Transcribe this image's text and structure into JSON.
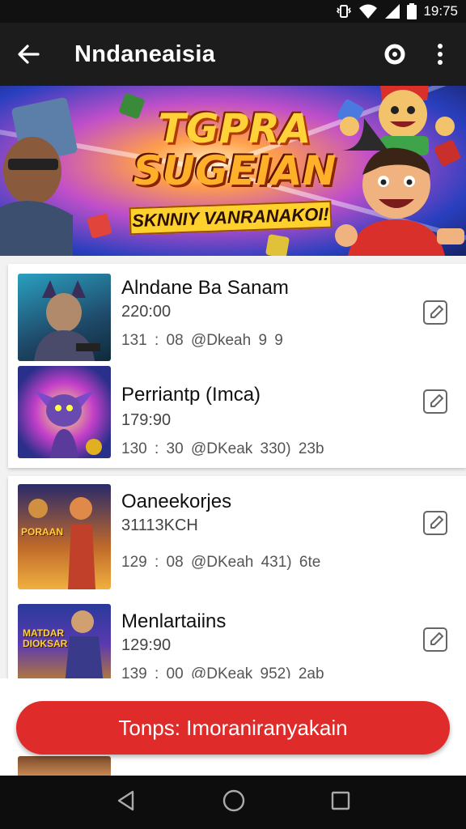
{
  "status_bar": {
    "time": "19:75",
    "icons": [
      "vibrate-icon",
      "wifi-icon",
      "signal-icon",
      "battery-icon"
    ]
  },
  "app_bar": {
    "title": "Nndaneaisia",
    "icons": [
      "back-arrow-icon",
      "search-icon",
      "more-vert-icon"
    ]
  },
  "banner": {
    "headline_line1": "TGPRA",
    "headline_line2": "SUGEIAN",
    "subtitle": "SKNNIY VANRANAKOI!"
  },
  "list": {
    "items": [
      {
        "title": "Alndane  Ba  Sanam",
        "subtitle": "220:00",
        "meta": "131 : 08   @Dkeah  9 9",
        "icon": "edit-icon"
      },
      {
        "title": "Perriantp  (Imca)",
        "subtitle": "179:90",
        "meta": "130 : 30   @DKeak  330)   23b",
        "icon": "edit-icon"
      },
      {
        "title": "Oaneekorjes",
        "subtitle": "31113KCH",
        "meta": "129 : 08   @DKeah  431)   6te",
        "icon": "edit-icon"
      },
      {
        "title": "Menlartaiins",
        "subtitle": "129:90",
        "meta": "139 : 00   @DKeak  952)   2ab",
        "icon": "edit-icon"
      }
    ],
    "thumb_texts": [
      "PORAAN",
      "MATDAR\nDIOKSAR"
    ]
  },
  "cta": {
    "label": "Tonps: Imoraniranyakain"
  },
  "nav_bar": {
    "icons": [
      "nav-back-icon",
      "nav-home-icon",
      "nav-recents-icon"
    ]
  },
  "colors": {
    "accent": "#e02b2b",
    "app_bar": "#1c1c1c",
    "status_bar": "#111111",
    "nav_bar": "#0d0d0d"
  }
}
